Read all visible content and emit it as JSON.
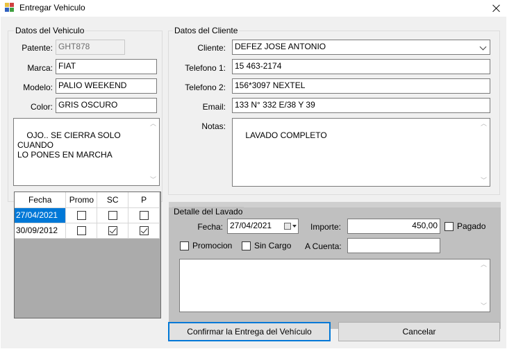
{
  "window": {
    "title": "Entregar Vehiculo"
  },
  "vehiculo": {
    "group_title": "Datos del Vehiculo",
    "patente_label": "Patente:",
    "patente": "GHT878",
    "marca_label": "Marca:",
    "marca": "FIAT",
    "modelo_label": "Modelo:",
    "modelo": "PALIO WEEKEND",
    "color_label": "Color:",
    "color": "GRIS OSCURO",
    "notas": "OJO.. SE CIERRA SOLO CUANDO\nLO PONES EN MARCHA"
  },
  "historial": {
    "columns": [
      "Fecha",
      "Promo",
      "SC",
      "P"
    ],
    "rows": [
      {
        "fecha": "27/04/2021",
        "promo": false,
        "sc": false,
        "p": false,
        "selected": true
      },
      {
        "fecha": "30/09/2012",
        "promo": false,
        "sc": true,
        "p": true,
        "selected": false
      }
    ]
  },
  "cliente": {
    "group_title": "Datos del Cliente",
    "cliente_label": "Cliente:",
    "cliente": "DEFEZ JOSE ANTONIO",
    "tel1_label": "Telefono 1:",
    "tel1": "15 463-2174",
    "tel2_label": "Telefono 2:",
    "tel2": "156*3097 NEXTEL",
    "email_label": "Email:",
    "email": "133 N° 332 E/38 Y 39",
    "notas_label": "Notas:",
    "notas": "LAVADO COMPLETO"
  },
  "lavado": {
    "group_title": "Detalle del Lavado",
    "fecha_label": "Fecha:",
    "fecha": "27/04/2021",
    "importe_label": "Importe:",
    "importe": "450,00",
    "pagado_label": "Pagado",
    "pagado": false,
    "promocion_label": "Promocion",
    "promocion": false,
    "sincargo_label": "Sin Cargo",
    "sincargo": false,
    "acuenta_label": "A Cuenta:",
    "acuenta": "",
    "observaciones": ""
  },
  "buttons": {
    "confirmar": "Confirmar la Entrega del Vehículo",
    "cancelar": "Cancelar"
  }
}
